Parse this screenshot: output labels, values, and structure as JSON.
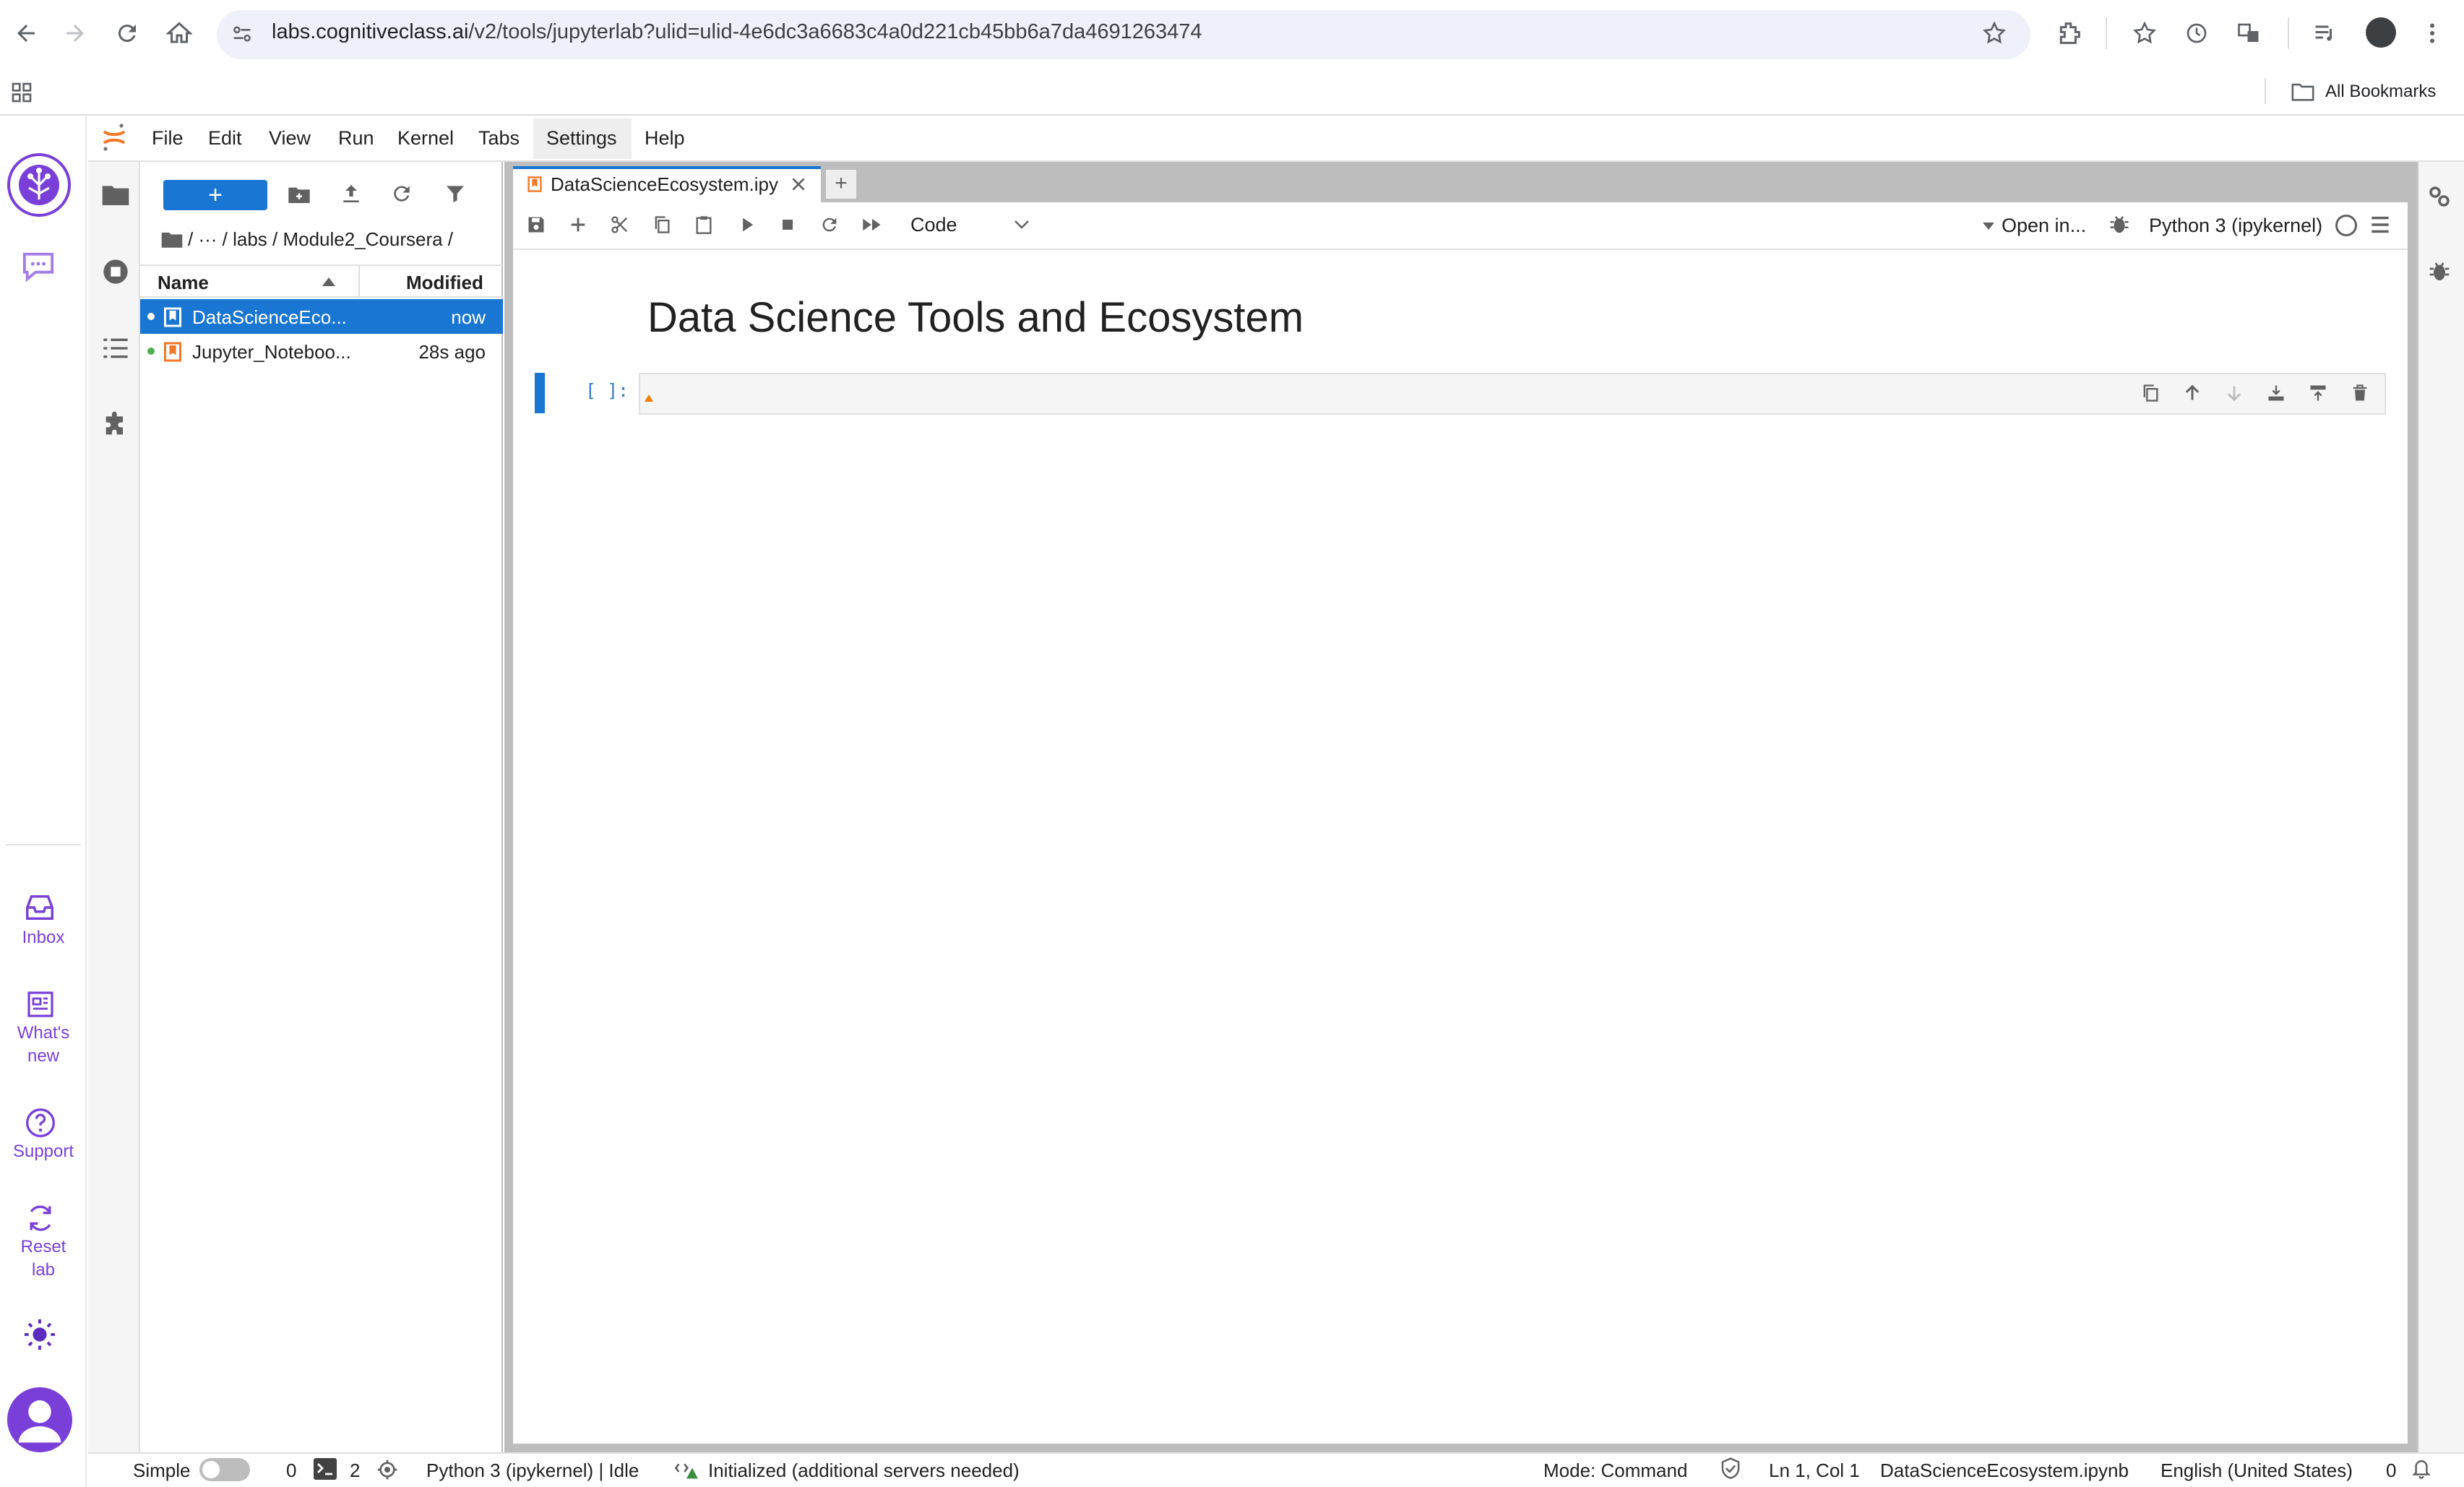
{
  "browser": {
    "url_host": "labs.cognitiveclass.ai",
    "url_path": "/v2/tools/jupyterlab?ulid=ulid-4e6dc3a6683c4a0d221cb45bb6a7da4691263474",
    "bookmarks_label": "All Bookmarks"
  },
  "left_rail": {
    "items": [
      {
        "label": "Inbox",
        "icon": "inbox-icon"
      },
      {
        "label_line1": "What's",
        "label_line2": "new",
        "icon": "newspaper-icon"
      },
      {
        "label": "Support",
        "icon": "question-icon"
      },
      {
        "label_line1": "Reset",
        "label_line2": "lab",
        "icon": "refresh-icon"
      }
    ],
    "accent_color": "#7a3fd9"
  },
  "menu": {
    "file": "File",
    "edit": "Edit",
    "view": "View",
    "run": "Run",
    "kernel": "Kernel",
    "tabs": "Tabs",
    "settings": "Settings",
    "help": "Help"
  },
  "file_browser": {
    "new_label": "+",
    "breadcrumb": "/   ···   / labs / Module2_Coursera /",
    "col_name": "Name",
    "col_modified": "Modified",
    "files": [
      {
        "name": "DataScienceEco...",
        "modified": "now",
        "selected": true
      },
      {
        "name": "Jupyter_Noteboo...",
        "modified": "28s ago",
        "selected": false
      }
    ],
    "selected_color": "#1976d2"
  },
  "notebook": {
    "tab_label": "DataScienceEcosystem.ipy",
    "add_tab": "+",
    "cell_type": "Code",
    "open_in": "Open in...",
    "kernel": "Python 3 (ipykernel)",
    "heading": "Data Science Tools and Ecosystem",
    "cell_prompt": "[ ]:"
  },
  "status": {
    "mode_label": "Simple",
    "terminals_count": "0",
    "kernels_count": "2",
    "kernel_status": "Python 3 (ipykernel) | Idle",
    "lsp_status": "Initialized (additional servers needed)",
    "mode": "Mode: Command",
    "cursor": "Ln 1, Col 1",
    "filename": "DataScienceEcosystem.ipynb",
    "language": "English (United States)",
    "notifications": "0"
  }
}
